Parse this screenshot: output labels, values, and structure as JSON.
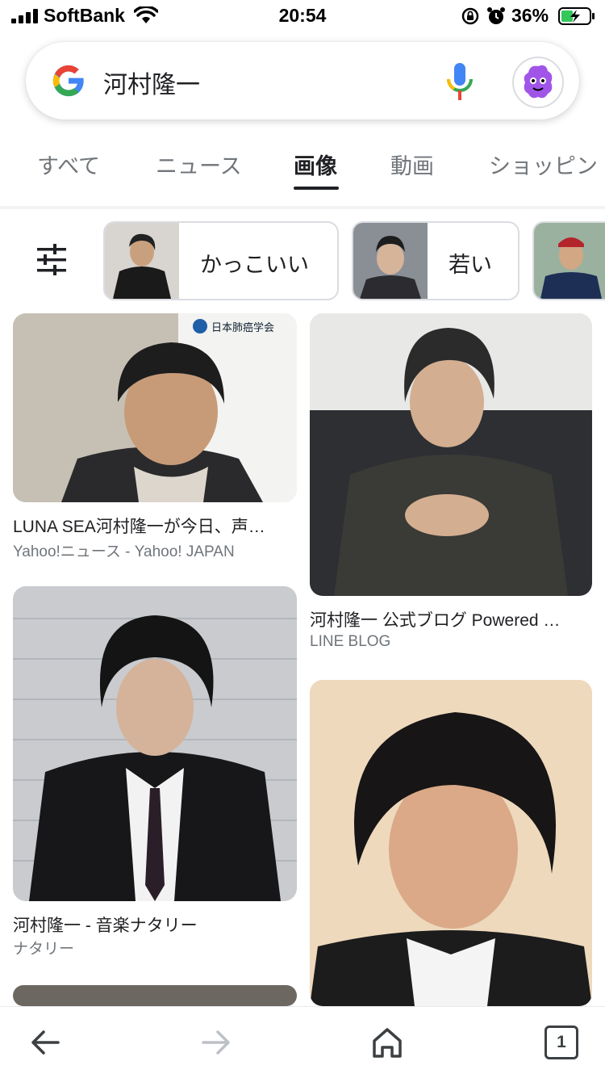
{
  "status_bar": {
    "carrier": "SoftBank",
    "time": "20:54",
    "battery_pct": "36%",
    "icons": [
      "signal-icon",
      "wifi-icon",
      "rotation-lock-icon",
      "alarm-icon",
      "battery-charging-icon"
    ]
  },
  "search": {
    "query": "河村隆一",
    "icons": [
      "google-logo-icon",
      "mic-icon",
      "avatar"
    ]
  },
  "tabs": [
    {
      "label": "すべて",
      "active": false
    },
    {
      "label": "ニュース",
      "active": false
    },
    {
      "label": "画像",
      "active": true
    },
    {
      "label": "動画",
      "active": false
    },
    {
      "label": "ショッピン",
      "active": false
    }
  ],
  "chips": [
    {
      "label": "かっこいい"
    },
    {
      "label": "若い"
    },
    {
      "label": ""
    }
  ],
  "results": [
    {
      "title": "LUNA SEA河村隆一が今日、声…",
      "source": "Yahoo!ニュース - Yahoo! JAPAN",
      "logo_text": "日本肺癌学会"
    },
    {
      "title": "河村隆一 公式ブログ Powered …",
      "source": "LINE BLOG"
    },
    {
      "title": "河村隆一 - 音楽ナタリー",
      "source": "ナタリー"
    },
    {
      "title": "",
      "source": ""
    },
    {
      "title": "",
      "source": ""
    }
  ],
  "toolbar": {
    "tab_count": "1",
    "icons": [
      "back-arrow-icon",
      "forward-arrow-icon",
      "home-icon",
      "tabs-icon"
    ]
  },
  "colors": {
    "google_blue": "#4285F4",
    "google_red": "#EA4335",
    "google_yellow": "#FBBC05",
    "google_green": "#34A853",
    "text_primary": "#202124",
    "text_secondary": "#70757a"
  }
}
